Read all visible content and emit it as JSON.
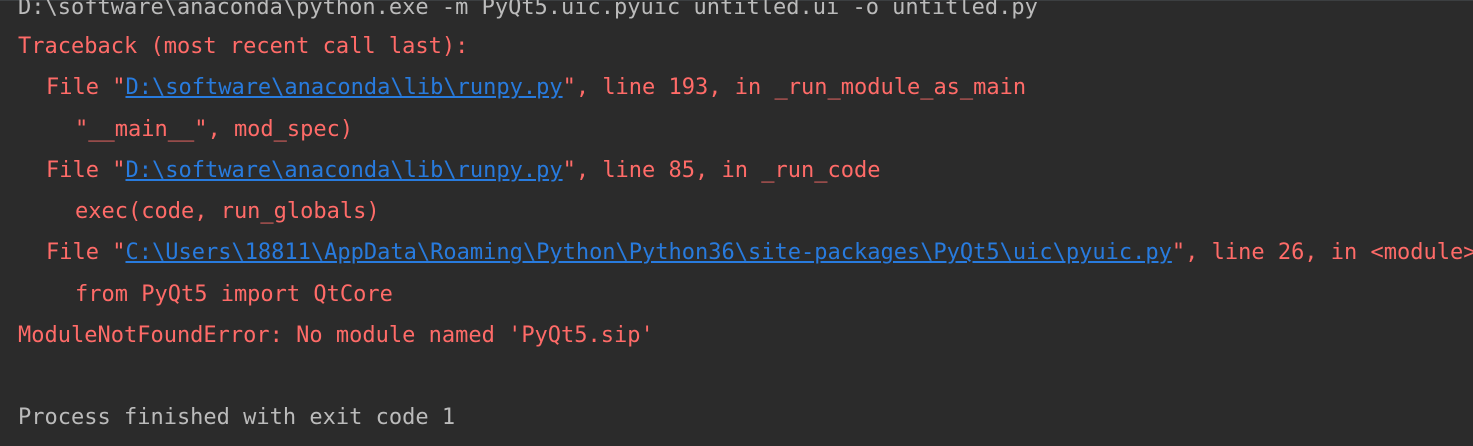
{
  "console": {
    "command_line": "D:\\software\\anaconda\\python.exe -m PyQt5.uic.pyuic untitled.ui -o untitled.py",
    "traceback_header": "Traceback (most recent call last):",
    "frames": [
      {
        "prefix": "File \"",
        "path": "D:\\software\\anaconda\\lib\\runpy.py",
        "suffix": "\", line 193, in _run_module_as_main",
        "code": "\"__main__\", mod_spec)"
      },
      {
        "prefix": "File \"",
        "path": "D:\\software\\anaconda\\lib\\runpy.py",
        "suffix": "\", line 85, in _run_code",
        "code": "exec(code, run_globals)"
      },
      {
        "prefix": "File \"",
        "path": "C:\\Users\\18811\\AppData\\Roaming\\Python\\Python36\\site-packages\\PyQt5\\uic\\pyuic.py",
        "suffix": "\", line 26, in <module>",
        "code": "from PyQt5 import QtCore"
      }
    ],
    "error_message": "ModuleNotFoundError: No module named 'PyQt5.sip'",
    "exit_message": "Process finished with exit code 1"
  },
  "colors": {
    "background": "#2b2b2b",
    "normal_text": "#bbbbbb",
    "error_text": "#ff6b68",
    "link": "#287bde"
  }
}
